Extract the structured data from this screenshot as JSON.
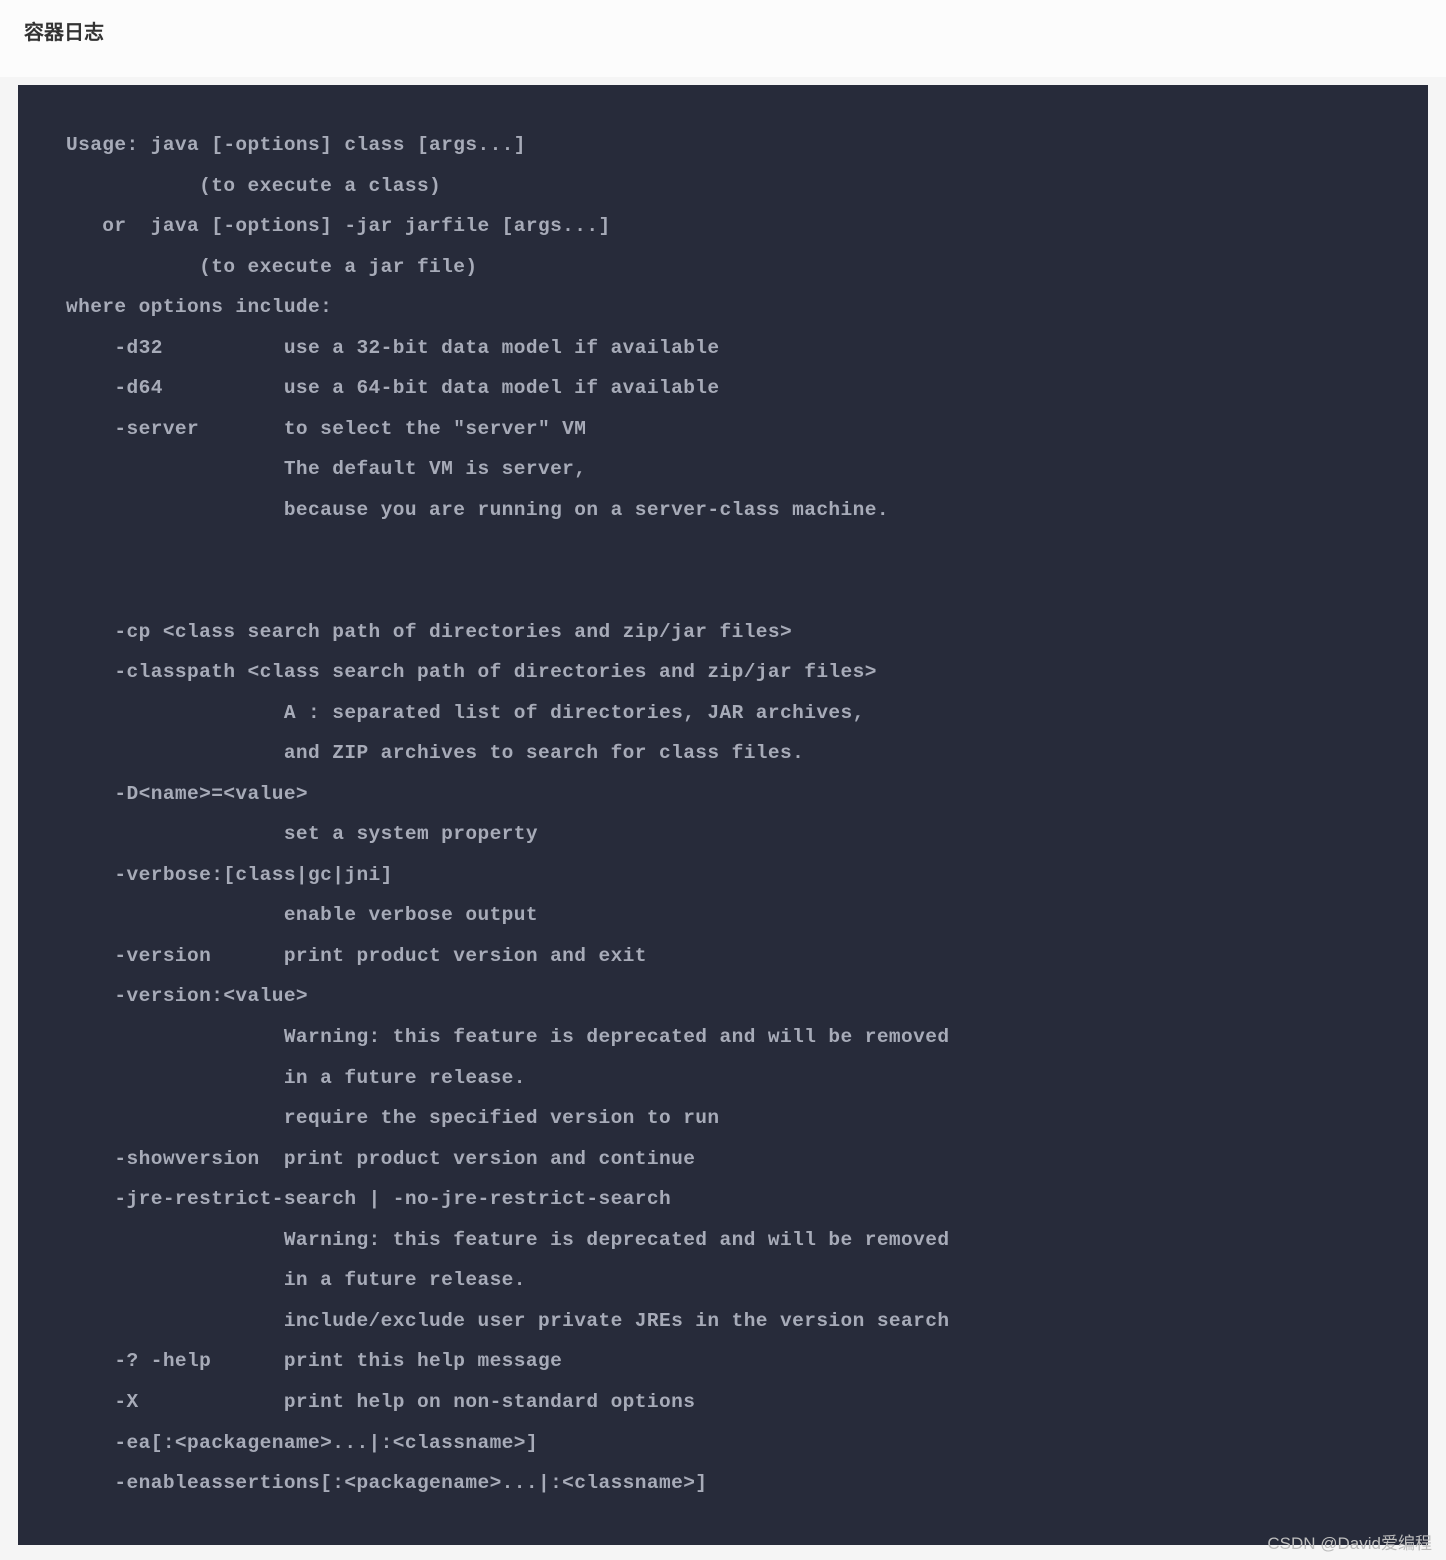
{
  "header": {
    "title": "容器日志"
  },
  "log": {
    "lines": [
      "Usage: java [-options] class [args...]",
      "           (to execute a class)",
      "   or  java [-options] -jar jarfile [args...]",
      "           (to execute a jar file)",
      "where options include:",
      "    -d32          use a 32-bit data model if available",
      "    -d64          use a 64-bit data model if available",
      "    -server       to select the \"server\" VM",
      "                  The default VM is server,",
      "                  because you are running on a server-class machine.",
      "",
      "",
      "    -cp <class search path of directories and zip/jar files>",
      "    -classpath <class search path of directories and zip/jar files>",
      "                  A : separated list of directories, JAR archives,",
      "                  and ZIP archives to search for class files.",
      "    -D<name>=<value>",
      "                  set a system property",
      "    -verbose:[class|gc|jni]",
      "                  enable verbose output",
      "    -version      print product version and exit",
      "    -version:<value>",
      "                  Warning: this feature is deprecated and will be removed",
      "                  in a future release.",
      "                  require the specified version to run",
      "    -showversion  print product version and continue",
      "    -jre-restrict-search | -no-jre-restrict-search",
      "                  Warning: this feature is deprecated and will be removed",
      "                  in a future release.",
      "                  include/exclude user private JREs in the version search",
      "    -? -help      print this help message",
      "    -X            print help on non-standard options",
      "    -ea[:<packagename>...|:<classname>]",
      "    -enableassertions[:<packagename>...|:<classname>]"
    ]
  },
  "watermark": {
    "text": "CSDN @David爱编程"
  }
}
